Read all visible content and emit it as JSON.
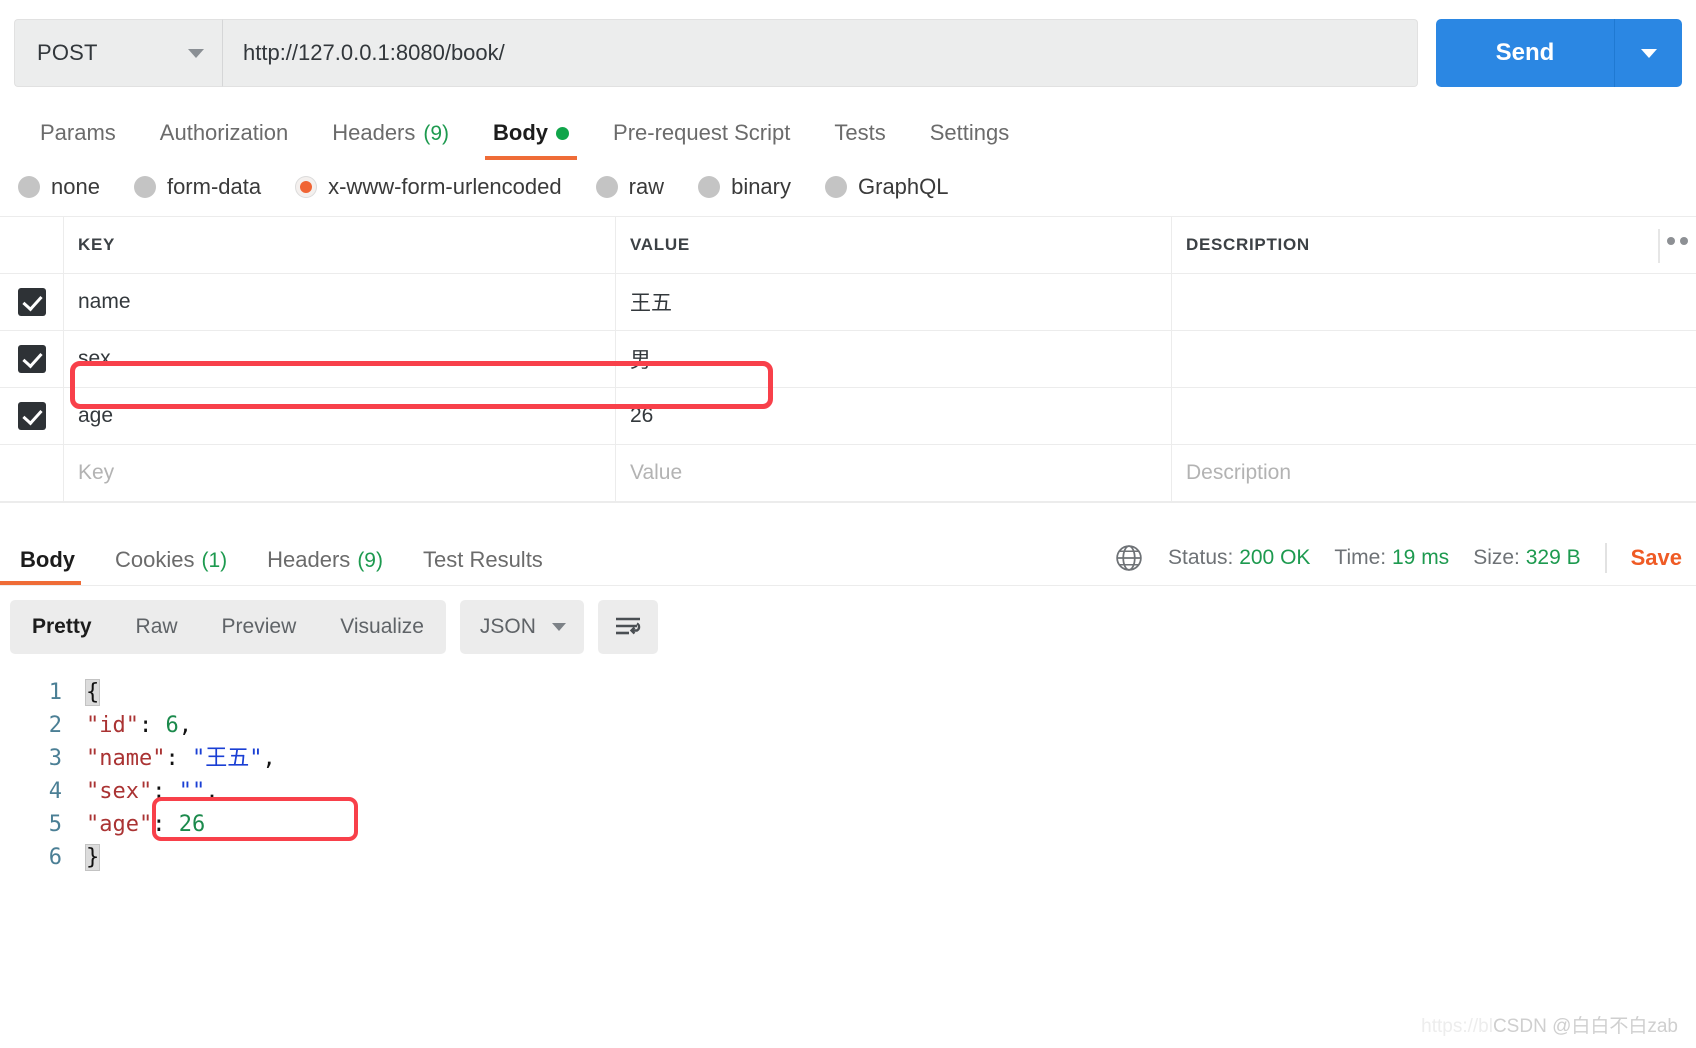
{
  "request": {
    "method": "POST",
    "url": "http://127.0.0.1:8080/book/",
    "send_label": "Send",
    "tabs": [
      {
        "label": "Params",
        "count": ""
      },
      {
        "label": "Authorization",
        "count": ""
      },
      {
        "label": "Headers",
        "count": "(9)"
      },
      {
        "label": "Body",
        "count": ""
      },
      {
        "label": "Pre-request Script",
        "count": ""
      },
      {
        "label": "Tests",
        "count": ""
      },
      {
        "label": "Settings",
        "count": ""
      }
    ],
    "body_modes": [
      {
        "label": "none"
      },
      {
        "label": "form-data"
      },
      {
        "label": "x-www-form-urlencoded"
      },
      {
        "label": "raw"
      },
      {
        "label": "binary"
      },
      {
        "label": "GraphQL"
      }
    ],
    "selected_mode": "x-www-form-urlencoded",
    "table": {
      "headers": {
        "key": "KEY",
        "value": "VALUE",
        "description": "DESCRIPTION"
      },
      "rows": [
        {
          "key": "name",
          "value": "王五",
          "description": ""
        },
        {
          "key": "sex",
          "value": "男",
          "description": ""
        },
        {
          "key": "age",
          "value": "26",
          "description": ""
        }
      ],
      "placeholder_row": {
        "key": "Key",
        "value": "Value",
        "description": "Description"
      }
    }
  },
  "response": {
    "tabs": [
      {
        "label": "Body",
        "count": ""
      },
      {
        "label": "Cookies",
        "count": "(1)"
      },
      {
        "label": "Headers",
        "count": "(9)"
      },
      {
        "label": "Test Results",
        "count": ""
      }
    ],
    "status_label": "Status:",
    "status_value": "200 OK",
    "time_label": "Time:",
    "time_value": "19 ms",
    "size_label": "Size:",
    "size_value": "329 B",
    "save_label": "Save",
    "view_modes": [
      {
        "label": "Pretty"
      },
      {
        "label": "Raw"
      },
      {
        "label": "Preview"
      },
      {
        "label": "Visualize"
      }
    ],
    "format": "JSON",
    "code_lines": [
      {
        "n": "1",
        "segments": [
          {
            "t": "{",
            "c": "brace"
          }
        ]
      },
      {
        "n": "2",
        "segments": [
          {
            "t": "    ",
            "c": "plain"
          },
          {
            "t": "\"id\"",
            "c": "key"
          },
          {
            "t": ": ",
            "c": "punc"
          },
          {
            "t": "6",
            "c": "num"
          },
          {
            "t": ",",
            "c": "punc"
          }
        ]
      },
      {
        "n": "3",
        "segments": [
          {
            "t": "    ",
            "c": "plain"
          },
          {
            "t": "\"name\"",
            "c": "key"
          },
          {
            "t": ": ",
            "c": "punc"
          },
          {
            "t": "\"王五\"",
            "c": "str"
          },
          {
            "t": ",",
            "c": "punc"
          }
        ]
      },
      {
        "n": "4",
        "segments": [
          {
            "t": "    ",
            "c": "plain"
          },
          {
            "t": "\"sex\"",
            "c": "key"
          },
          {
            "t": ": ",
            "c": "punc"
          },
          {
            "t": "\"\"",
            "c": "str"
          },
          {
            "t": ",",
            "c": "punc"
          }
        ]
      },
      {
        "n": "5",
        "segments": [
          {
            "t": "    ",
            "c": "plain"
          },
          {
            "t": "\"age\"",
            "c": "key"
          },
          {
            "t": ": ",
            "c": "punc"
          },
          {
            "t": "26",
            "c": "num"
          }
        ]
      },
      {
        "n": "6",
        "segments": [
          {
            "t": "}",
            "c": "brace"
          }
        ]
      }
    ]
  },
  "annotations": {
    "highlight_row_key": "sex",
    "highlight_code_line": "4",
    "color": "#f8404a"
  },
  "watermark": {
    "faint_prefix": "https://bl",
    "text": "CSDN @白白不白zab"
  },
  "colors": {
    "accent": "#ef6c37",
    "send": "#2b87e3",
    "ok_green": "#1d9a4f"
  }
}
